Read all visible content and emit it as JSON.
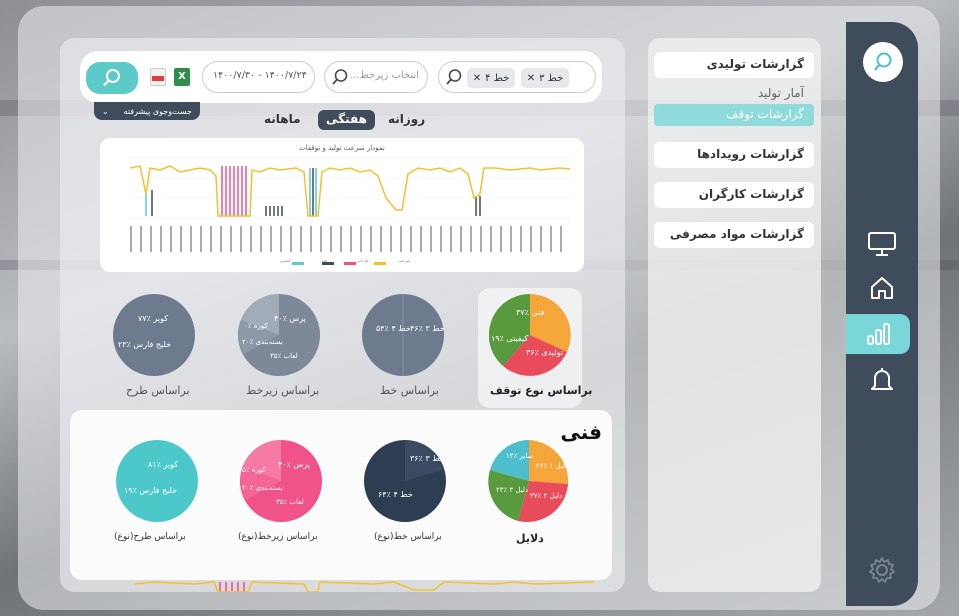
{
  "nav": {
    "items": [
      {
        "icon": "monitor-icon"
      },
      {
        "icon": "home-icon"
      },
      {
        "icon": "bar-chart-icon",
        "active": true
      },
      {
        "icon": "bell-icon"
      }
    ],
    "settings_icon": "gear-icon",
    "search_icon": "search-icon"
  },
  "reports": {
    "production": "گزارشات تولیدی",
    "production_stats": "آمار تولید",
    "stop_reports": "گزارشات توقف",
    "events": "گزارشات رویدادها",
    "workers": "گزارشات کارگران",
    "materials": "گزارشات مواد مصرفی"
  },
  "filters": {
    "tag1": "خط ۳",
    "tag2": "خط ۴",
    "sub_placeholder": "انتخاب زیرخط...",
    "date_range": "۱۴۰۰/۷/۳۰ - ۱۴۰۰/۷/۲۴",
    "advanced": "جست‌وجوی پیشرفته",
    "pdf_icon": "pdf-icon",
    "excel_icon": "excel-icon"
  },
  "periods": {
    "daily": "روزانه",
    "weekly": "هفتگی",
    "monthly": "ماهانه",
    "active": "weekly"
  },
  "line_chart": {
    "title": "نمودار سرعت تولید و توقفات",
    "legend": [
      "سرعت",
      "طراحی",
      "فنی",
      "کیفیتی"
    ]
  },
  "pies_top": [
    {
      "label": "براساس نوع توقف",
      "slices": [
        "فنی ٪۳۷",
        "کیفیتی ٪۱۹",
        "تولیدی ٪۳۶"
      ]
    },
    {
      "label": "براساس خط",
      "slices": [
        "خط ۴ ٪۵۴",
        "خط ۳ ٪۴۶"
      ]
    },
    {
      "label": "براساس زیرخط",
      "slices": [
        "پرس ٪۴۰",
        "کوره ٪۰",
        "بسته‌بندی ٪۲۰",
        "لعاب ٪۳۵"
      ]
    },
    {
      "label": "براساس طرح",
      "slices": [
        "کویر ٪۷۷",
        "خلیج فارس ٪۲۳"
      ]
    }
  ],
  "tech": {
    "title": "فنی",
    "pies": [
      {
        "label": "دلایل",
        "slices": [
          "سایر ٪۱۴",
          "دلیل ۱ ٪۲۶",
          "دلیل ۲ ٪۳۷",
          "دلیل ۳ ٪۲۳"
        ]
      },
      {
        "label": "براساس خط(نوع)",
        "slices": [
          "خط ۳ ٪۳۶",
          "خط ۴ ٪۶۴"
        ]
      },
      {
        "label": "براساس زیرخط(نوع)",
        "slices": [
          "پرس ٪۴۰",
          "کوره ٪۵",
          "بسته‌بندی ٪۲۰",
          "لعاب ٪۳۵"
        ]
      },
      {
        "label": "براساس طرح(نوع)",
        "slices": [
          "کویر ٪۸۱",
          "خلیج فارس ٪۱۹"
        ]
      }
    ]
  },
  "colors": {
    "accent": "#5ccac8",
    "dark": "#3f4c5c",
    "pink": "#f0528a",
    "yellow": "#f3c12e",
    "orange": "#f4a63a",
    "red": "#e84b5a",
    "green": "#5a9a3e"
  }
}
